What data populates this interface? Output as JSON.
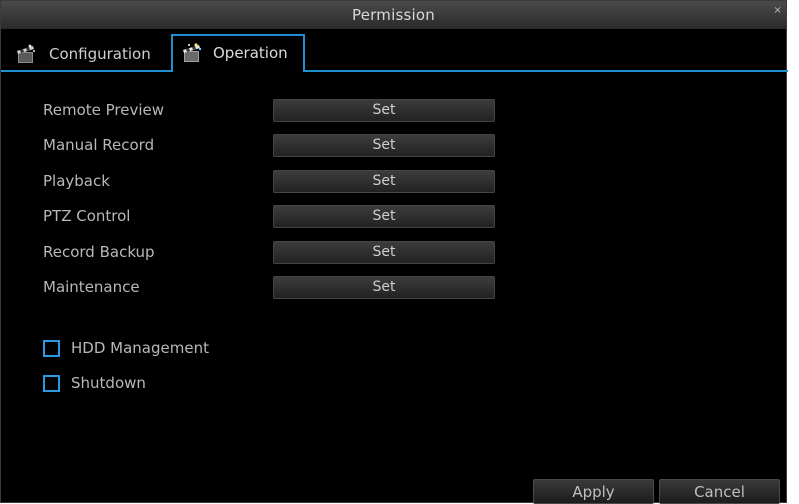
{
  "window": {
    "title": "Permission",
    "close_glyph": "×"
  },
  "tabs": [
    {
      "label": "Configuration",
      "icon": "film-clapper-icon",
      "active": false
    },
    {
      "label": "Operation",
      "icon": "film-clapper-icon",
      "active": true
    }
  ],
  "permissions": [
    {
      "label": "Remote Preview",
      "button": "Set"
    },
    {
      "label": "Manual Record",
      "button": "Set"
    },
    {
      "label": "Playback",
      "button": "Set"
    },
    {
      "label": "PTZ Control",
      "button": "Set"
    },
    {
      "label": "Record Backup",
      "button": "Set"
    },
    {
      "label": "Maintenance",
      "button": "Set"
    }
  ],
  "checkboxes": [
    {
      "label": "HDD Management",
      "checked": false
    },
    {
      "label": "Shutdown",
      "checked": false
    }
  ],
  "footer": {
    "apply_label": "Apply",
    "cancel_label": "Cancel"
  },
  "colors": {
    "accent": "#1e8fd0",
    "background": "#000000",
    "text": "#b8b8b8"
  }
}
